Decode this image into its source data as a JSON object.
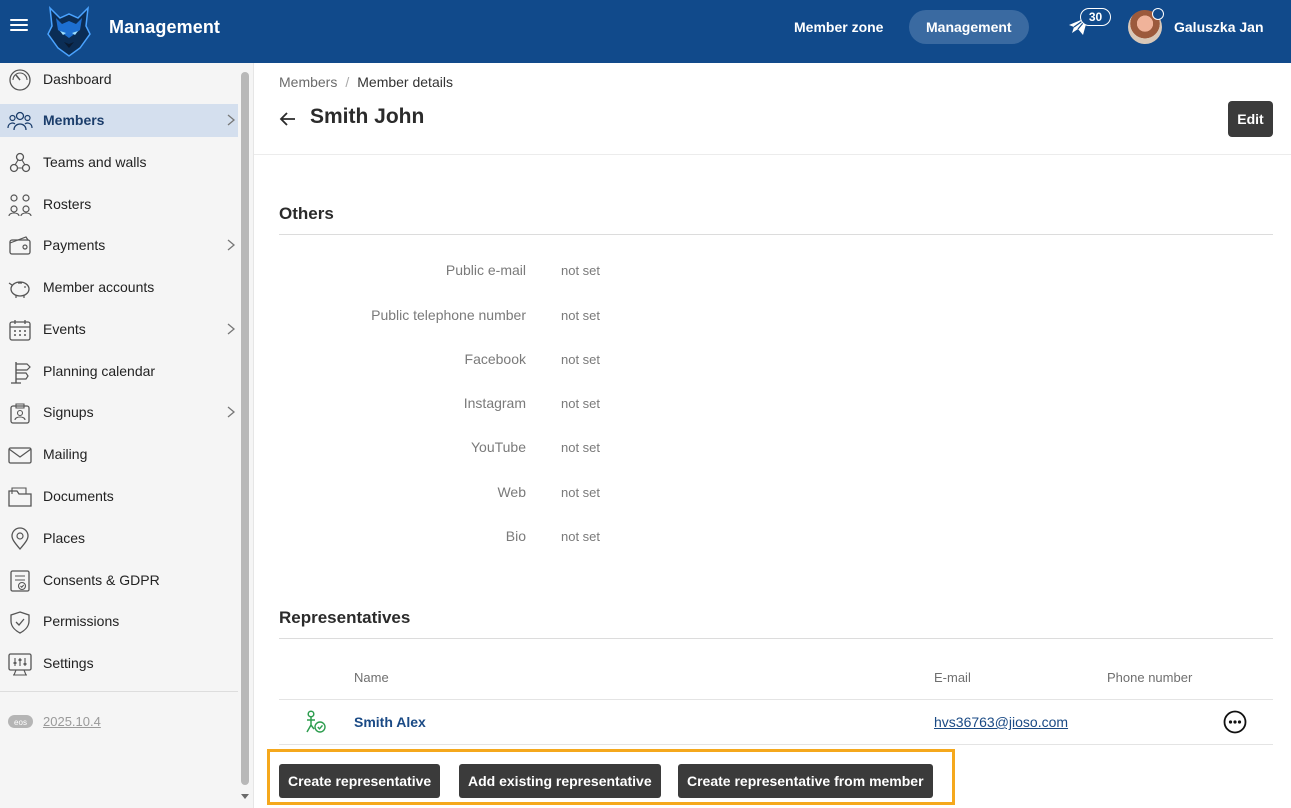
{
  "topbar": {
    "app_title": "Management",
    "nav": [
      {
        "label": "Member zone",
        "active": false
      },
      {
        "label": "Management",
        "active": true
      }
    ],
    "notification_count": "30",
    "user_name": "Galuszka Jan",
    "brand_color": "#114a8b"
  },
  "sidebar": {
    "items": [
      {
        "label": "Dashboard",
        "icon": "dashboard-gauge-icon",
        "has_submenu": false,
        "active": false
      },
      {
        "label": "Members",
        "icon": "members-group-icon",
        "has_submenu": true,
        "active": true
      },
      {
        "label": "Teams and walls",
        "icon": "teams-icon",
        "has_submenu": false,
        "active": false
      },
      {
        "label": "Rosters",
        "icon": "rosters-icon",
        "has_submenu": false,
        "active": false
      },
      {
        "label": "Payments",
        "icon": "wallet-icon",
        "has_submenu": true,
        "active": false
      },
      {
        "label": "Member accounts",
        "icon": "piggy-bank-icon",
        "has_submenu": false,
        "active": false
      },
      {
        "label": "Events",
        "icon": "calendar-icon",
        "has_submenu": true,
        "active": false
      },
      {
        "label": "Planning calendar",
        "icon": "signpost-icon",
        "has_submenu": false,
        "active": false
      },
      {
        "label": "Signups",
        "icon": "signup-board-icon",
        "has_submenu": true,
        "active": false
      },
      {
        "label": "Mailing",
        "icon": "envelope-icon",
        "has_submenu": false,
        "active": false
      },
      {
        "label": "Documents",
        "icon": "folder-icon",
        "has_submenu": false,
        "active": false
      },
      {
        "label": "Places",
        "icon": "map-pin-icon",
        "has_submenu": false,
        "active": false
      },
      {
        "label": "Consents & GDPR",
        "icon": "consent-document-icon",
        "has_submenu": false,
        "active": false
      },
      {
        "label": "Permissions",
        "icon": "shield-check-icon",
        "has_submenu": false,
        "active": false
      },
      {
        "label": "Settings",
        "icon": "settings-sliders-icon",
        "has_submenu": false,
        "active": false
      }
    ],
    "version_badge": "eos",
    "version": "2025.10.4",
    "active_bg": "#d4dfee"
  },
  "breadcrumb": {
    "items": [
      "Members",
      "Member details"
    ],
    "separator": "/"
  },
  "page": {
    "title": "Smith John",
    "edit_label": "Edit"
  },
  "others": {
    "title": "Others",
    "fields": [
      {
        "label": "Public e-mail",
        "value": "not set"
      },
      {
        "label": "Public telephone number",
        "value": "not set"
      },
      {
        "label": "Facebook",
        "value": "not set"
      },
      {
        "label": "Instagram",
        "value": "not set"
      },
      {
        "label": "YouTube",
        "value": "not set"
      },
      {
        "label": "Web",
        "value": "not set"
      },
      {
        "label": "Bio",
        "value": "not set"
      }
    ]
  },
  "representatives": {
    "title": "Representatives",
    "columns": [
      "Name",
      "E-mail",
      "Phone number"
    ],
    "rows": [
      {
        "name": "Smith Alex",
        "email": "hvs36763@jioso.com",
        "phone": ""
      }
    ],
    "actions": [
      "Create representative",
      "Add existing representative",
      "Create representative from member"
    ],
    "highlight_color": "#f5a81c"
  }
}
